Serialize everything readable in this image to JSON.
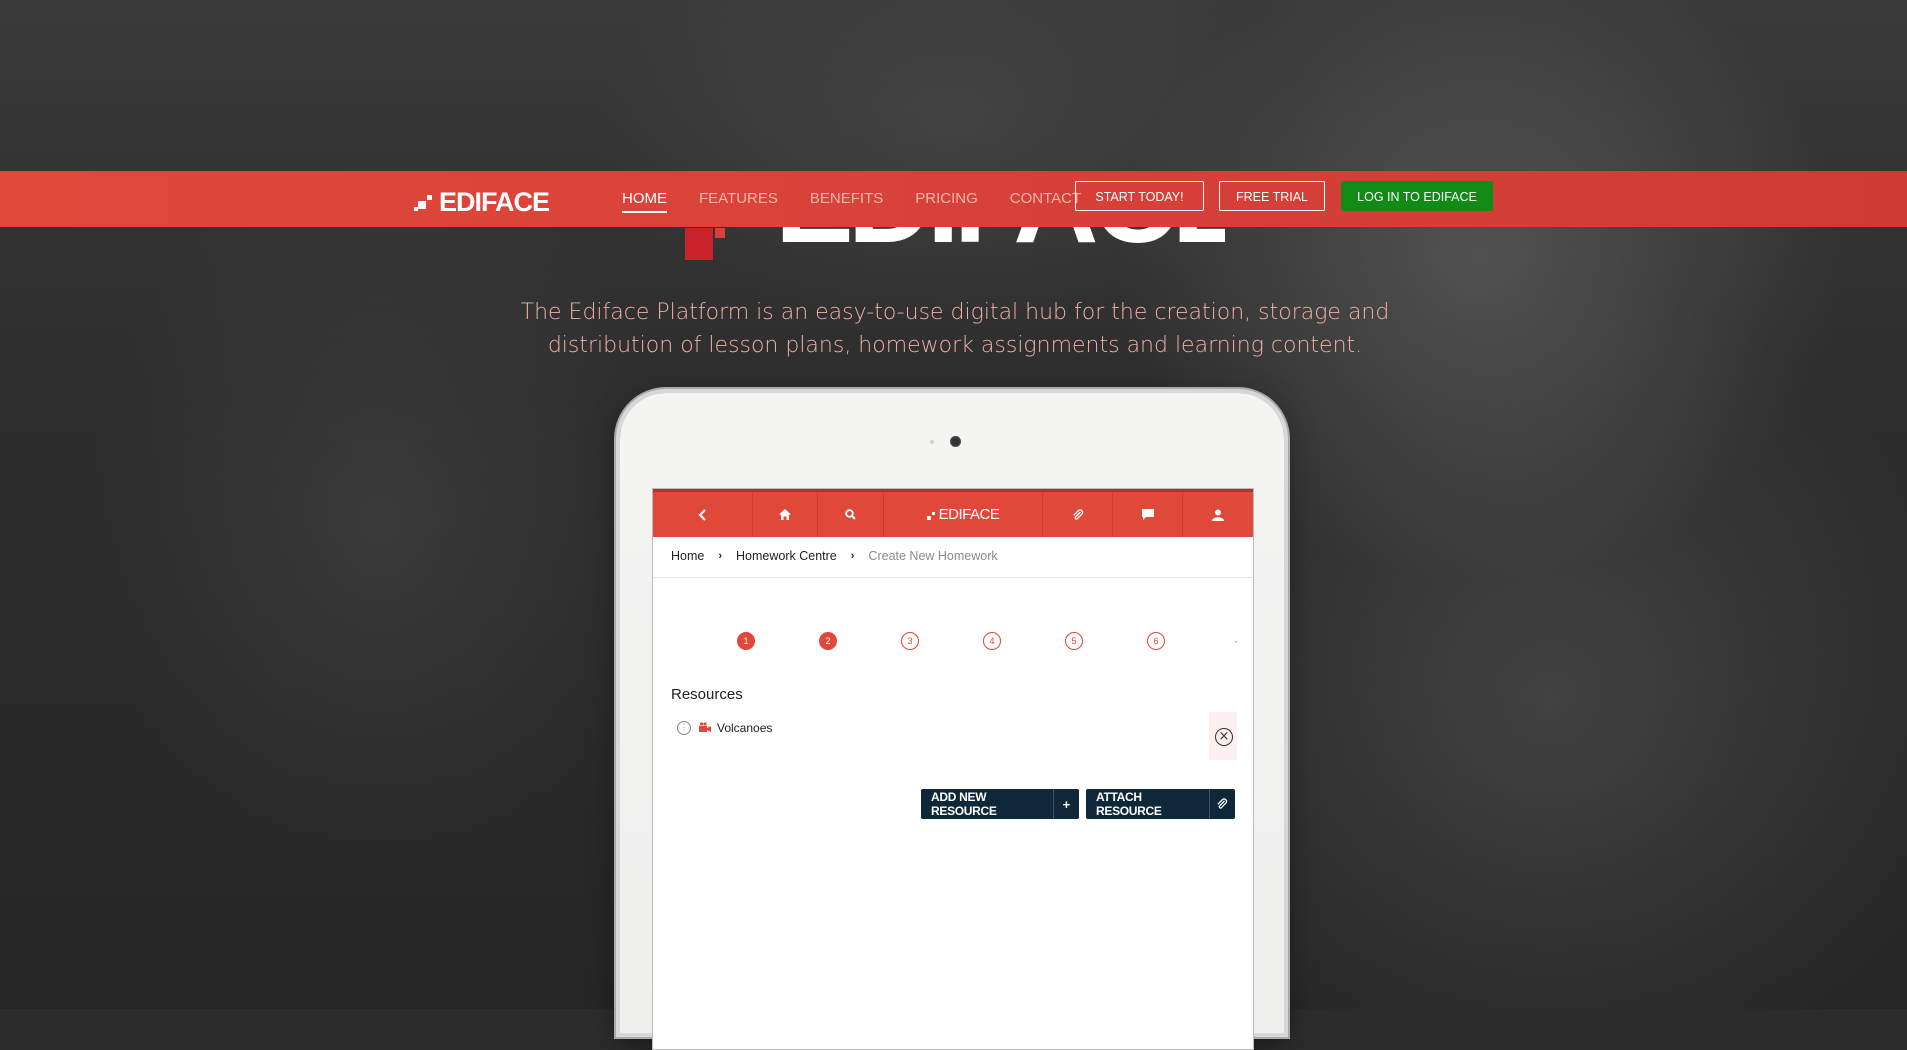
{
  "brand": {
    "name": "EDIFACE",
    "accent": "#e0483a",
    "dark_accent": "#c8232a",
    "login_green": "#118a16"
  },
  "nav": {
    "links": [
      {
        "label": "HOME",
        "active": true
      },
      {
        "label": "FEATURES",
        "active": false
      },
      {
        "label": "BENEFITS",
        "active": false
      },
      {
        "label": "PRICING",
        "active": false
      },
      {
        "label": "CONTACT",
        "active": false
      }
    ],
    "start_label": "START TODAY!",
    "trial_label": "FREE TRIAL",
    "login_label": "LOG IN TO EDIFACE"
  },
  "hero": {
    "big_logo": "EDIFACE",
    "tagline_line1": "The Ediface Platform is an easy-to-use digital hub for the creation, storage and",
    "tagline_line2": "distribution of lesson plans, homework assignments and learning content."
  },
  "app": {
    "toolbar": {
      "back_icon": "chevron-left-icon",
      "home_icon": "home-icon",
      "search_icon": "search-icon",
      "logo": "EDIFACE",
      "attach_icon": "paperclip-icon",
      "chat_icon": "chat-icon",
      "user_icon": "user-icon"
    },
    "breadcrumb": [
      "Home",
      "Homework Centre",
      "Create New Homework"
    ],
    "steps": [
      "1",
      "2",
      "3",
      "4",
      "5",
      "6"
    ],
    "completed_steps": 2,
    "section_title": "Resources",
    "resource": {
      "name": "Volcanoes"
    },
    "add_label": "ADD NEW RESOURCE",
    "add_suffix": "+",
    "attach_label": "ATTACH RESOURCE"
  }
}
